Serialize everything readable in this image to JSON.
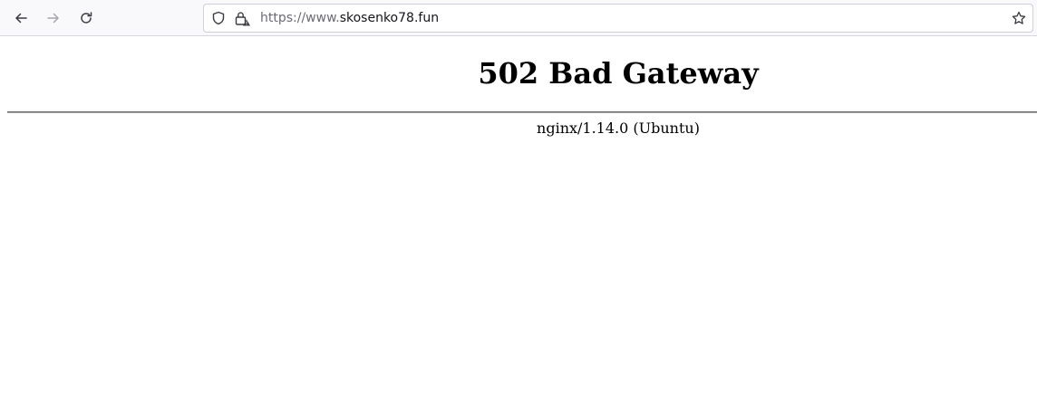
{
  "browser": {
    "url_scheme": "https://www.",
    "url_host": "skosenko78.fun",
    "icons": {
      "back": "arrow-left-icon",
      "forward": "arrow-right-icon",
      "reload": "reload-icon",
      "tracking": "shield-icon",
      "security": "lock-warning-icon",
      "bookmark": "star-icon"
    }
  },
  "page": {
    "title": "502 Bad Gateway",
    "server_signature": "nginx/1.14.0 (Ubuntu)"
  }
}
